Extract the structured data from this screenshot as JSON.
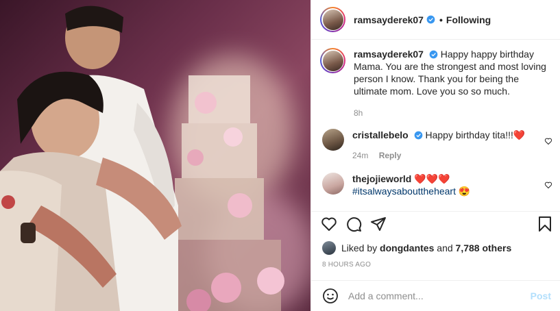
{
  "header": {
    "username": "ramsayderek07",
    "separator": "•",
    "follow_status": "Following"
  },
  "caption": {
    "username": "ramsayderek07",
    "text": "Happy happy birthday Mama. You are the strongest and most loving person I know. Thank you for being the ultimate mom. Love you so so much.",
    "time": "8h"
  },
  "comments": [
    {
      "username": "cristallebelo",
      "text": "Happy birthday tita!!!",
      "emoji": "❤️",
      "time": "24m",
      "reply_label": "Reply"
    },
    {
      "username": "thejojieworld",
      "emoji": "❤️❤️❤️",
      "hashtag": "#itsalwaysabouttheheart",
      "trailing_emoji": "😍"
    }
  ],
  "likes": {
    "prefix": "Liked by",
    "user": "dongdantes",
    "joiner": "and",
    "others": "7,788 others"
  },
  "timestamp": "8 HOURS AGO",
  "add_comment": {
    "placeholder": "Add a comment...",
    "post_label": "Post"
  },
  "colors": {
    "verified": "#3897f0",
    "link_blue": "#00376b",
    "post_disabled": "#b2dffc",
    "muted": "#8e8e8e"
  },
  "icons": [
    "heart-icon",
    "comment-icon",
    "share-icon",
    "bookmark-icon",
    "emoji-icon",
    "verified-badge-icon"
  ]
}
